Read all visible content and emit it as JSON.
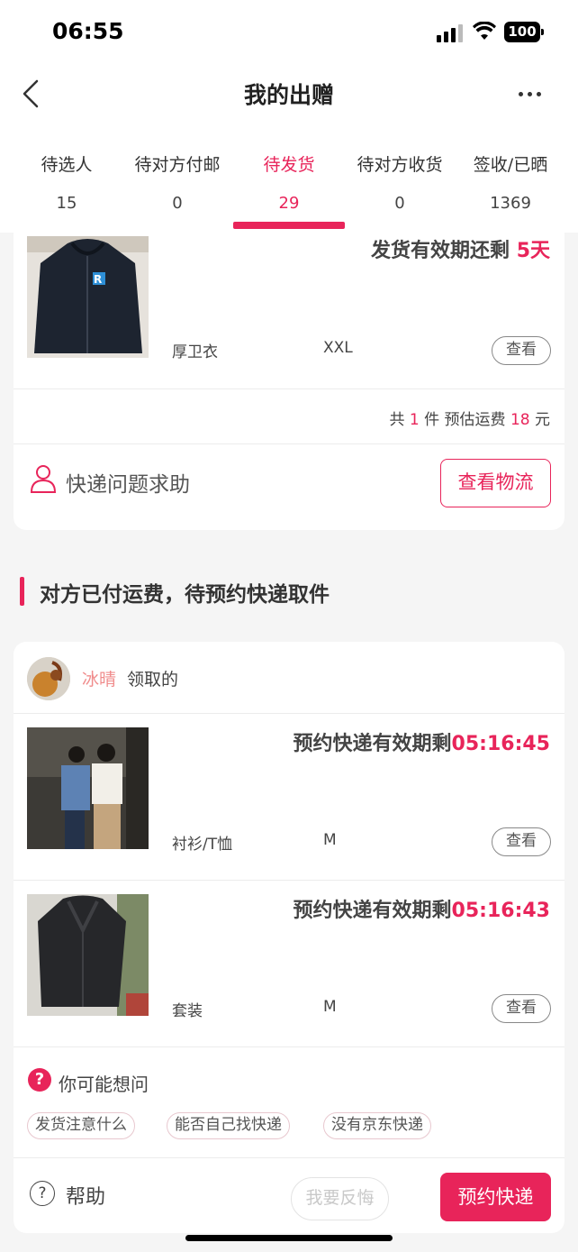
{
  "status_bar": {
    "time": "06:55",
    "battery": "100"
  },
  "nav": {
    "title": "我的出赠"
  },
  "tabs": [
    {
      "label": "待选人",
      "count": "15"
    },
    {
      "label": "待对方付邮",
      "count": "0"
    },
    {
      "label": "待发货",
      "count": "29",
      "active": true
    },
    {
      "label": "待对方收货",
      "count": "0"
    },
    {
      "label": "签收/已晒",
      "count": "1369"
    }
  ],
  "card1": {
    "deadline_prefix": "发货有效期还剩 ",
    "deadline_value": "5天",
    "item": {
      "name": "厚卫衣",
      "size": "XXL",
      "view_label": "查看"
    },
    "summary": {
      "prefix": "共 ",
      "count": "1",
      "mid": " 件 预估运费 ",
      "fee": "18",
      "suffix": " 元"
    },
    "help_text": "快递问题求助",
    "logistics_button": "查看物流"
  },
  "section": {
    "title": "对方已付运费，待预约快递取件"
  },
  "card2": {
    "claimer_name": "冰晴",
    "claimed_suffix": "领取的",
    "items": [
      {
        "timer_prefix": "预约快递有效期剩",
        "timer_value": "05:16:45",
        "name": "衬衫/T恤",
        "size": "M",
        "view_label": "查看"
      },
      {
        "timer_prefix": "预约快递有效期剩",
        "timer_value": "05:16:43",
        "name": "套装",
        "size": "M",
        "view_label": "查看"
      }
    ],
    "faq": {
      "title": "你可能想问",
      "chips": [
        "发货注意什么",
        "能否自己找快递",
        "没有京东快递"
      ]
    },
    "help_label": "帮助",
    "regret_button": "我要反悔",
    "book_button": "预约快递"
  },
  "colors": {
    "accent": "#e8245a",
    "claimer": "#f08c8c"
  },
  "icons": [
    "back-arrow-icon",
    "more-dots-icon",
    "user-icon",
    "question-icon",
    "help-icon"
  ]
}
